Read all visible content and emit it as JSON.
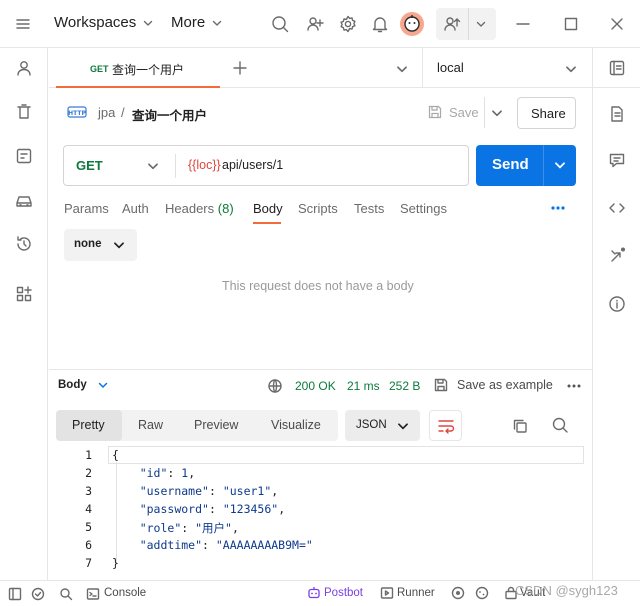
{
  "topbar": {
    "workspaces_label": "Workspaces",
    "more_label": "More",
    "icons": [
      "menu-icon",
      "search-icon",
      "add-user-icon",
      "settings-icon",
      "bell-icon",
      "avatar",
      "invite-icon",
      "minimize-icon",
      "maximize-icon",
      "close-icon"
    ]
  },
  "tab": {
    "method": "GET",
    "title": "查询一个用户",
    "environment": "local"
  },
  "breadcrumb": {
    "collection": "jpa",
    "separator": "/",
    "request": "查询一个用户",
    "save_label": "Save",
    "share_label": "Share"
  },
  "request": {
    "method": "GET",
    "url_var": "{{loc}}",
    "url_path": "api/users/1",
    "send_label": "Send",
    "tabs": [
      "Params",
      "Auth",
      "Headers",
      "Body",
      "Scripts",
      "Tests",
      "Settings"
    ],
    "headers_count": "(8)",
    "active_tab": "Body",
    "body_type": "none",
    "empty_message": "This request does not have a body"
  },
  "response": {
    "section_label": "Body",
    "status": "200 OK",
    "time": "21 ms",
    "size": "252 B",
    "save_example_label": "Save as example",
    "views": [
      "Pretty",
      "Raw",
      "Preview",
      "Visualize"
    ],
    "format": "JSON",
    "line_numbers": [
      "1",
      "2",
      "3",
      "4",
      "5",
      "6",
      "7"
    ],
    "lines": [
      [
        {
          "t": "{",
          "c": "p"
        }
      ],
      [
        {
          "t": "    ",
          "c": "p"
        },
        {
          "t": "\"id\"",
          "c": "k"
        },
        {
          "t": ": ",
          "c": "p"
        },
        {
          "t": "1",
          "c": "n"
        },
        {
          "t": ",",
          "c": "p"
        }
      ],
      [
        {
          "t": "    ",
          "c": "p"
        },
        {
          "t": "\"username\"",
          "c": "k"
        },
        {
          "t": ": ",
          "c": "p"
        },
        {
          "t": "\"user1\"",
          "c": "s"
        },
        {
          "t": ",",
          "c": "p"
        }
      ],
      [
        {
          "t": "    ",
          "c": "p"
        },
        {
          "t": "\"password\"",
          "c": "k"
        },
        {
          "t": ": ",
          "c": "p"
        },
        {
          "t": "\"123456\"",
          "c": "s"
        },
        {
          "t": ",",
          "c": "p"
        }
      ],
      [
        {
          "t": "    ",
          "c": "p"
        },
        {
          "t": "\"role\"",
          "c": "k"
        },
        {
          "t": ": ",
          "c": "p"
        },
        {
          "t": "\"用户\"",
          "c": "s"
        },
        {
          "t": ",",
          "c": "p"
        }
      ],
      [
        {
          "t": "    ",
          "c": "p"
        },
        {
          "t": "\"addtime\"",
          "c": "k"
        },
        {
          "t": ": ",
          "c": "p"
        },
        {
          "t": "\"AAAAAAAAB9M=\"",
          "c": "s"
        }
      ],
      [
        {
          "t": "}",
          "c": "p"
        }
      ]
    ]
  },
  "statusbar": {
    "console_label": "Console",
    "postbot_label": "Postbot",
    "runner_label": "Runner",
    "vault_label": "Vault",
    "watermark": "CSDN @sygh123"
  },
  "colors": {
    "accent": "#f26b3a",
    "send_blue": "#0b74e5",
    "get_green": "#0c7a3b",
    "status_green": "#0c7a3b",
    "url_var": "#e0463d"
  }
}
